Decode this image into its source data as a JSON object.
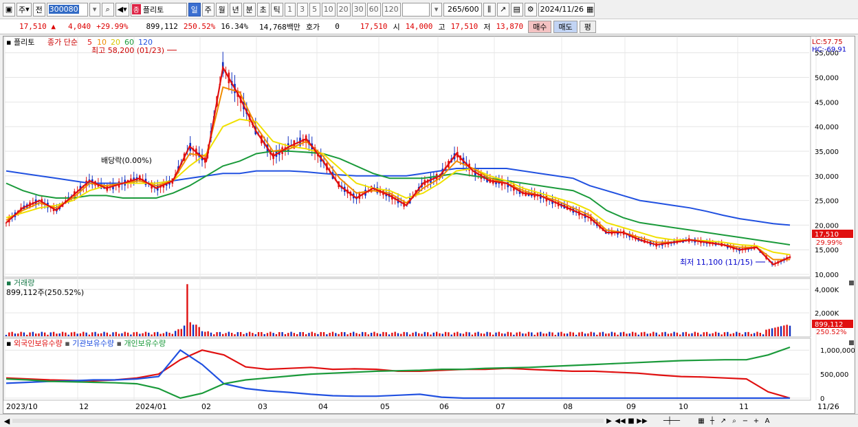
{
  "toolbar": {
    "period_label": "주",
    "prev_label": "전",
    "code": "300080",
    "name_tag": "종",
    "name": "플리토",
    "periods": [
      "일",
      "주",
      "월",
      "년",
      "분",
      "초",
      "틱"
    ],
    "active_period": "일",
    "intervals": [
      "1",
      "3",
      "5",
      "10",
      "20",
      "30",
      "60",
      "120"
    ],
    "count": "265/600",
    "date": "2024/11/26"
  },
  "quote": {
    "price": "17,510",
    "change": "4,040",
    "change_pct": "+29.99%",
    "volume": "899,112",
    "volume_ratio": "250.52%",
    "turnover": "16.34%",
    "amount": "14,768백만",
    "hoga_label": "호가",
    "hoga_value": "0",
    "ask": "17,510",
    "open_label": "시",
    "open": "14,000",
    "high_label": "고",
    "high": "17,510",
    "low_label": "저",
    "low": "13,870",
    "buy_label": "매수",
    "sell_label": "매도",
    "eval_label": "평"
  },
  "chart": {
    "stock_label": "플리토",
    "ma_label": "종가 단순",
    "ma_periods": [
      "5",
      "10",
      "20",
      "60",
      "120"
    ],
    "high_annotation": "최고 58,200 (01/23)",
    "low_annotation": "최저 11,100 (11/15)",
    "dividend_annotation": "배당락(0.00%)",
    "lc": "LC:57.75",
    "hc": "HC:-69.91",
    "current_price_label": "17,510",
    "current_pct_label": "29.99%",
    "volume_title": "거래량",
    "volume_value": "899,112주(250.52%)",
    "volume_tag": "899,112",
    "volume_pct_tag": "250.52%",
    "holdings_foreign": "외국인보유수량",
    "holdings_inst": "기관보유수량",
    "holdings_indiv": "개인보유수량",
    "price_ticks": [
      "55,000",
      "50,000",
      "45,000",
      "40,000",
      "35,000",
      "30,000",
      "25,000",
      "20,000",
      "15,000",
      "10,000"
    ],
    "volume_ticks": [
      "4,000K",
      "2,000K"
    ],
    "holdings_ticks": [
      "1,000,000",
      "500,000",
      "0"
    ],
    "x_ticks": [
      "2023/10",
      "12",
      "2024/01",
      "02",
      "03",
      "04",
      "05",
      "06",
      "07",
      "08",
      "09",
      "10",
      "11",
      "11/26"
    ],
    "colors": {
      "ma5": "#e01010",
      "ma10": "#f08c00",
      "ma20": "#f0e000",
      "ma60": "#1a9a3a",
      "ma120": "#2050e0",
      "up": "#e01010",
      "down": "#1030c0"
    }
  },
  "chart_data": {
    "type": "line",
    "title": "플리토",
    "x_range": [
      "2023/10",
      "2024/11/26"
    ],
    "price_range": [
      10000,
      57750
    ],
    "series": [
      {
        "name": "5",
        "values": [
          20500,
          23500,
          25000,
          23000,
          26000,
          29000,
          27500,
          28500,
          29500,
          27500,
          29000,
          36000,
          33000,
          52000,
          46000,
          39000,
          34000,
          36000,
          37500,
          33000,
          28000,
          25500,
          27500,
          26000,
          24000,
          28500,
          30000,
          34500,
          31000,
          29000,
          28500,
          26500,
          26000,
          24500,
          23000,
          21500,
          18500,
          18500,
          17000,
          16000,
          16500,
          17000,
          16500,
          16000,
          15000,
          15500,
          12000,
          13500
        ]
      },
      {
        "name": "10",
        "values": [
          21000,
          23000,
          24500,
          23500,
          25500,
          28500,
          28000,
          28500,
          29000,
          28000,
          29000,
          34500,
          34000,
          48000,
          47000,
          40000,
          35000,
          35500,
          37000,
          34000,
          29500,
          26500,
          27000,
          26500,
          24500,
          27500,
          29500,
          33000,
          31500,
          29500,
          28500,
          27000,
          26000,
          25000,
          23500,
          22000,
          19000,
          18500,
          17500,
          16500,
          16500,
          17000,
          16500,
          16000,
          15500,
          15500,
          13000,
          13000
        ]
      },
      {
        "name": "20",
        "values": [
          21500,
          22500,
          23500,
          24000,
          25000,
          27000,
          28000,
          28500,
          28500,
          28500,
          29000,
          32000,
          34500,
          40000,
          41500,
          41000,
          37000,
          36000,
          35500,
          34500,
          31500,
          28500,
          27500,
          27000,
          25500,
          26500,
          28500,
          31000,
          31500,
          30000,
          29000,
          27500,
          26500,
          25500,
          24500,
          23000,
          20500,
          19500,
          18500,
          17500,
          17000,
          17000,
          16800,
          16500,
          16000,
          15800,
          14500,
          14000
        ]
      },
      {
        "name": "60",
        "values": [
          28500,
          27000,
          26000,
          25500,
          25500,
          26000,
          26000,
          25500,
          25500,
          25500,
          26500,
          28000,
          30000,
          32000,
          33000,
          34500,
          35000,
          35000,
          34800,
          34500,
          33500,
          32000,
          30500,
          29500,
          29500,
          29500,
          30000,
          30500,
          30000,
          29500,
          29000,
          28500,
          28000,
          27500,
          27000,
          25500,
          23000,
          21500,
          20500,
          20000,
          19500,
          19000,
          18500,
          18000,
          17500,
          17000,
          16500,
          16000
        ]
      },
      {
        "name": "120",
        "values": [
          31000,
          30500,
          30000,
          29500,
          29000,
          28500,
          28500,
          28500,
          28500,
          28500,
          29000,
          29500,
          30000,
          30500,
          30500,
          31000,
          31000,
          31000,
          30800,
          30500,
          30200,
          30000,
          30000,
          30000,
          30000,
          30500,
          31000,
          31500,
          31500,
          31500,
          31500,
          31000,
          30500,
          30000,
          29500,
          28000,
          27000,
          26000,
          25000,
          24500,
          24000,
          23500,
          22800,
          22000,
          21300,
          20800,
          20300,
          20000
        ]
      }
    ],
    "volume_max_k": 4700,
    "holdings": [
      {
        "name": "외국인보유수량",
        "values": [
          420000,
          400000,
          380000,
          370000,
          360000,
          380000,
          420000,
          500000,
          800000,
          1000000,
          900000,
          650000,
          600000,
          620000,
          640000,
          600000,
          610000,
          600000,
          560000,
          560000,
          580000,
          600000,
          600000,
          620000,
          600000,
          580000,
          560000,
          560000,
          540000,
          520000,
          480000,
          450000,
          440000,
          420000,
          400000,
          130000,
          0
        ]
      },
      {
        "name": "기관보유수량",
        "values": [
          310000,
          330000,
          350000,
          360000,
          380000,
          380000,
          400000,
          450000,
          1000000,
          700000,
          300000,
          200000,
          150000,
          120000,
          80000,
          50000,
          40000,
          40000,
          60000,
          80000,
          20000,
          0,
          0,
          0,
          0,
          0,
          0,
          0,
          0,
          0,
          0,
          0,
          0,
          0,
          0,
          0,
          0
        ]
      },
      {
        "name": "개인보유수량",
        "values": [
          400000,
          380000,
          350000,
          340000,
          330000,
          320000,
          300000,
          200000,
          0,
          100000,
          300000,
          380000,
          420000,
          460000,
          500000,
          520000,
          540000,
          560000,
          570000,
          580000,
          600000,
          600000,
          620000,
          630000,
          640000,
          660000,
          680000,
          700000,
          720000,
          740000,
          760000,
          780000,
          790000,
          800000,
          800000,
          900000,
          1060000
        ]
      }
    ]
  }
}
